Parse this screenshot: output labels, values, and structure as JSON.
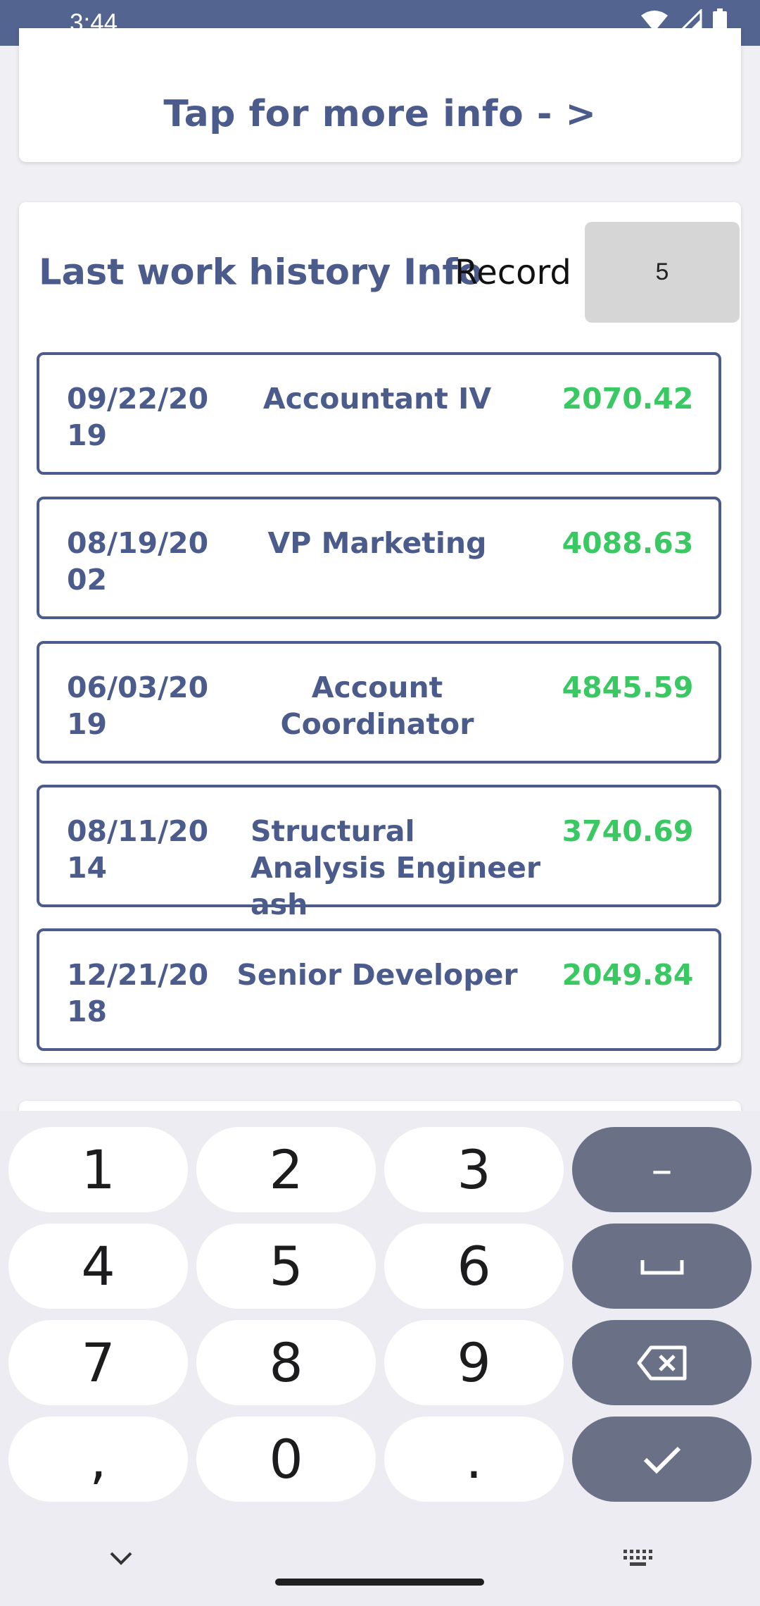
{
  "status_bar": {
    "time": "3:44"
  },
  "info_card": {
    "text": "Tap for more info - >"
  },
  "history": {
    "title": "Last work history Info",
    "record_label": "Record",
    "record_value": "5",
    "rows": [
      {
        "date": "09/22/2019",
        "title": "Accountant IV",
        "amount": "2070.42"
      },
      {
        "date": "08/19/2002",
        "title": "VP Marketing",
        "amount": "4088.63"
      },
      {
        "date": "06/03/2019",
        "title": "Account Coordinator",
        "amount": "4845.59"
      },
      {
        "date": "08/11/2014",
        "title": "Structural Analysis Engineer ash",
        "amount": "3740.69"
      },
      {
        "date": "12/21/2018",
        "title": "Senior Developer",
        "amount": "2049.84"
      }
    ]
  },
  "keyboard": {
    "keys": [
      "1",
      "2",
      "3",
      "–",
      "4",
      "5",
      "6",
      "space",
      "7",
      "8",
      "9",
      "backspace",
      ",",
      "0",
      ".",
      "done"
    ]
  },
  "colors": {
    "accent": "#4b5c8c",
    "status_bar": "#52648f",
    "amount": "#39c862",
    "key_dark": "#6a7186"
  }
}
